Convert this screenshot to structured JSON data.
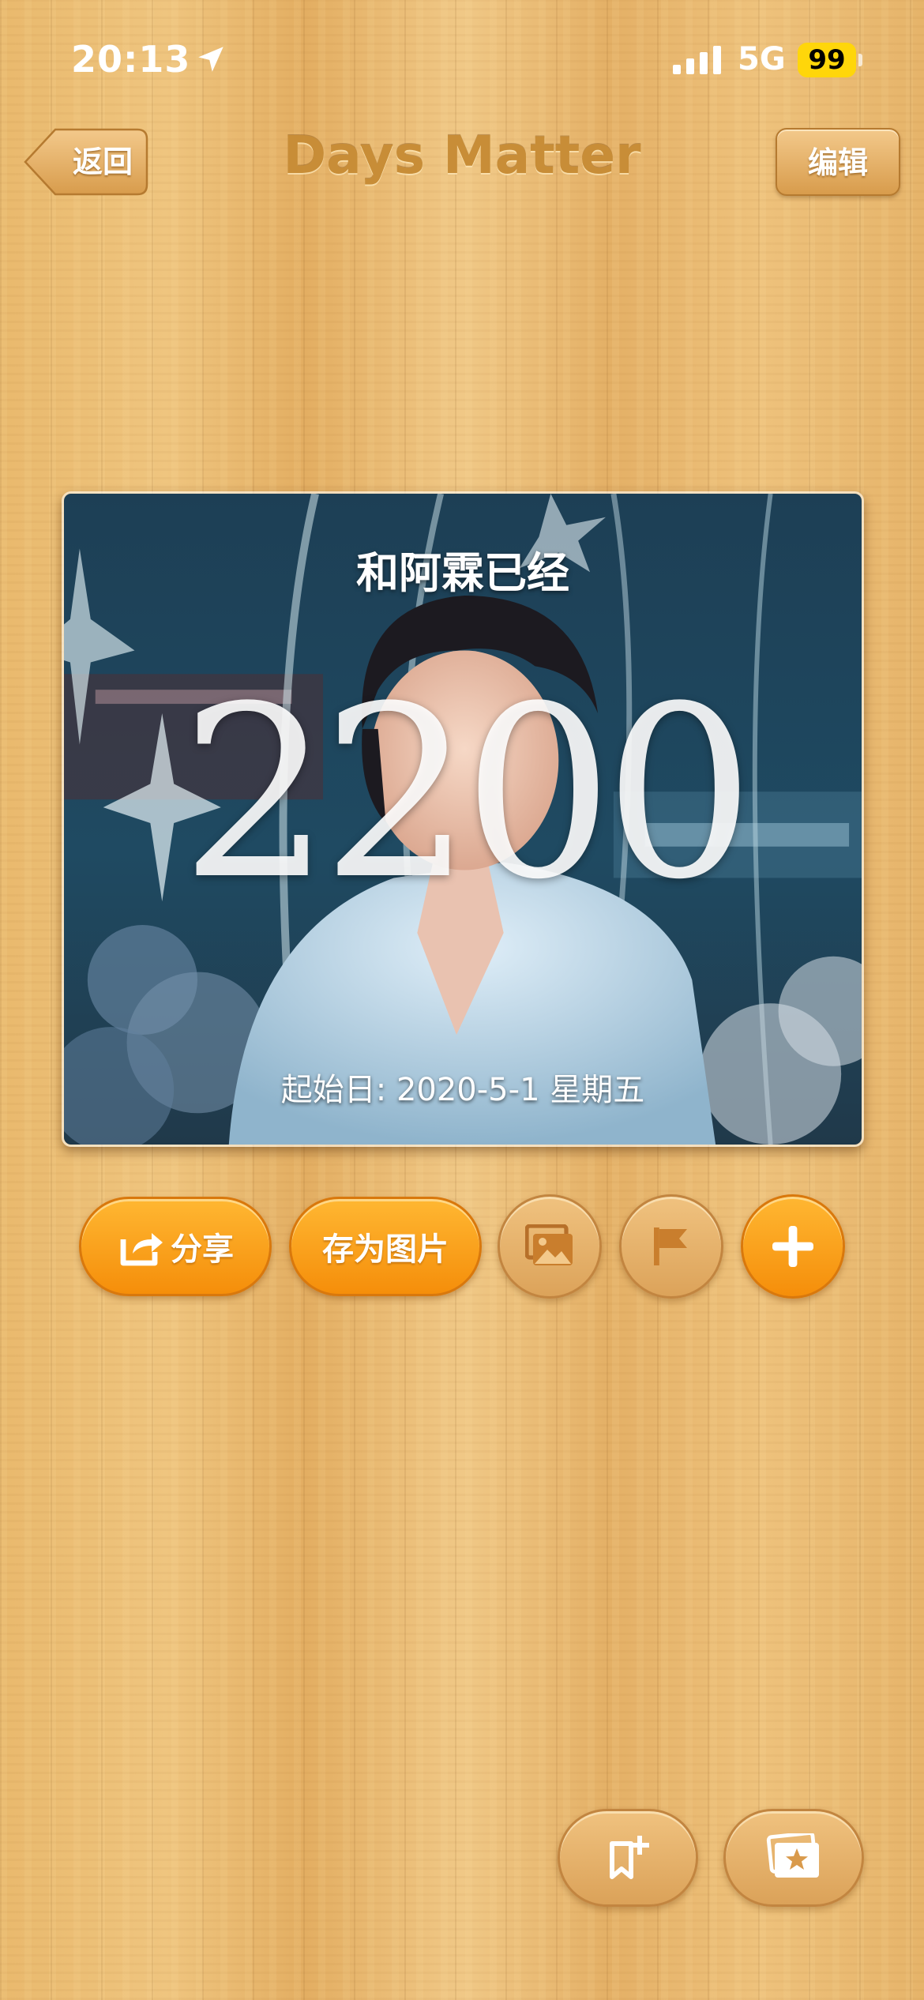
{
  "status_bar": {
    "time": "20:13",
    "network": "5G",
    "battery": "99"
  },
  "nav": {
    "back_label": "返回",
    "title": "Days Matter",
    "edit_label": "编辑"
  },
  "card": {
    "heading": "和阿霖已经",
    "days": "2200",
    "start_date": "起始日: 2020-5-1 星期五"
  },
  "actions": {
    "share_label": "分享",
    "save_image_label": "存为图片"
  },
  "icons": [
    "location-arrow-icon",
    "signal-icon",
    "share-icon",
    "image-icon",
    "flag-icon",
    "plus-icon",
    "bookmark-add-icon",
    "gallery-star-icon"
  ],
  "colors": {
    "accent_orange": "#f7a11c",
    "wood": "#e8b86a",
    "title_brown": "#c88d37",
    "battery_yellow": "#ffd60a"
  }
}
